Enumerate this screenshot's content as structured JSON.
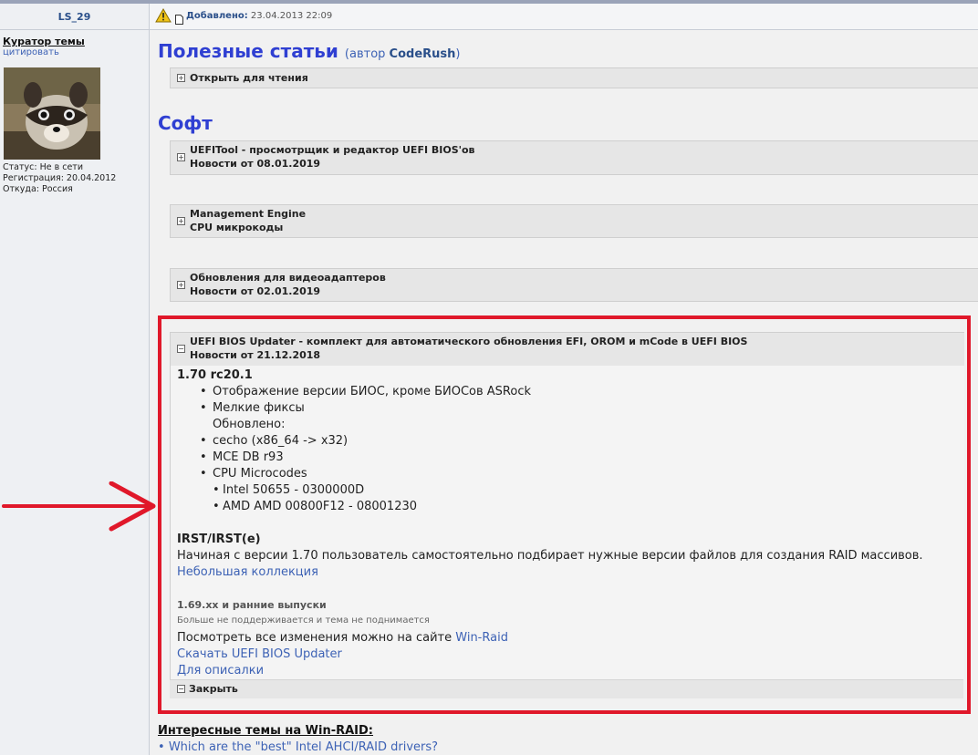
{
  "left": {
    "username": "LS_29",
    "curator": "Куратор темы",
    "quote": "цитировать",
    "status": "Статус: Не в сети",
    "registered": "Регистрация: 20.04.2012",
    "from": "Откуда: Россия"
  },
  "header": {
    "added_label": "Добавлено:",
    "added_date": "23.04.2013 22:09"
  },
  "useful": {
    "title": "Полезные статьи",
    "author_prefix": "(автор",
    "author_name": "CodeRush",
    "author_suffix": ")",
    "spoiler": "Открыть для чтения"
  },
  "soft": {
    "title": "Софт",
    "spoilers": [
      {
        "line1": "UEFITool - просмотрщик и редактор UEFI BIOS'ов",
        "line2": "Новости от 08.01.2019"
      },
      {
        "line1": "Management Engine",
        "line2": "CPU микрокоды"
      },
      {
        "line1": "Обновления для видеоадаптеров",
        "line2": "Новости от 02.01.2019"
      },
      {
        "line1": "UEFI BIOS Updater - комплект для автоматического обновления EFI, OROM и mCode в UEFI BIOS",
        "line2": "Новости от 21.12.2018"
      }
    ]
  },
  "open": {
    "version": "1.70 rc20.1",
    "b1": "Отображение версии БИОС, кроме БИОСов ASRock",
    "b2": "Мелкие фиксы",
    "updated": "Обновлено:",
    "b3": "cecho (x86_64 -> x32)",
    "b4": "MCE DB r93",
    "b5": "CPU Microcodes",
    "s1": "Intel 50655 - 0300000D",
    "s2": "AMD AMD 00800F12 - 08001230",
    "irst": "IRST/IRST(e)",
    "irst_text": "Начиная с версии 1.70 пользователь самостоятельно подбирает нужные версии файлов для создания RAID массивов.",
    "collection": "Небольшая коллекция",
    "old": "1.69.xx и ранние выпуски",
    "old_note": "Больше не поддерживается и тема не поднимается",
    "changes_prefix": "Посмотреть все изменения можно на сайте",
    "changes_link": "Win-Raid",
    "download": "Скачать UEFI BIOS Updater",
    "for_desc": "Для описалки",
    "close": "Закрыть"
  },
  "bottom": {
    "interesting": "Интересные темы на Win-RAID:",
    "item1": "Which are the \"best\" Intel AHCI/RAID drivers?"
  },
  "colors": {
    "annotation": "#e0182a",
    "heading": "#2f3fd2",
    "link": "#3d62b5"
  }
}
